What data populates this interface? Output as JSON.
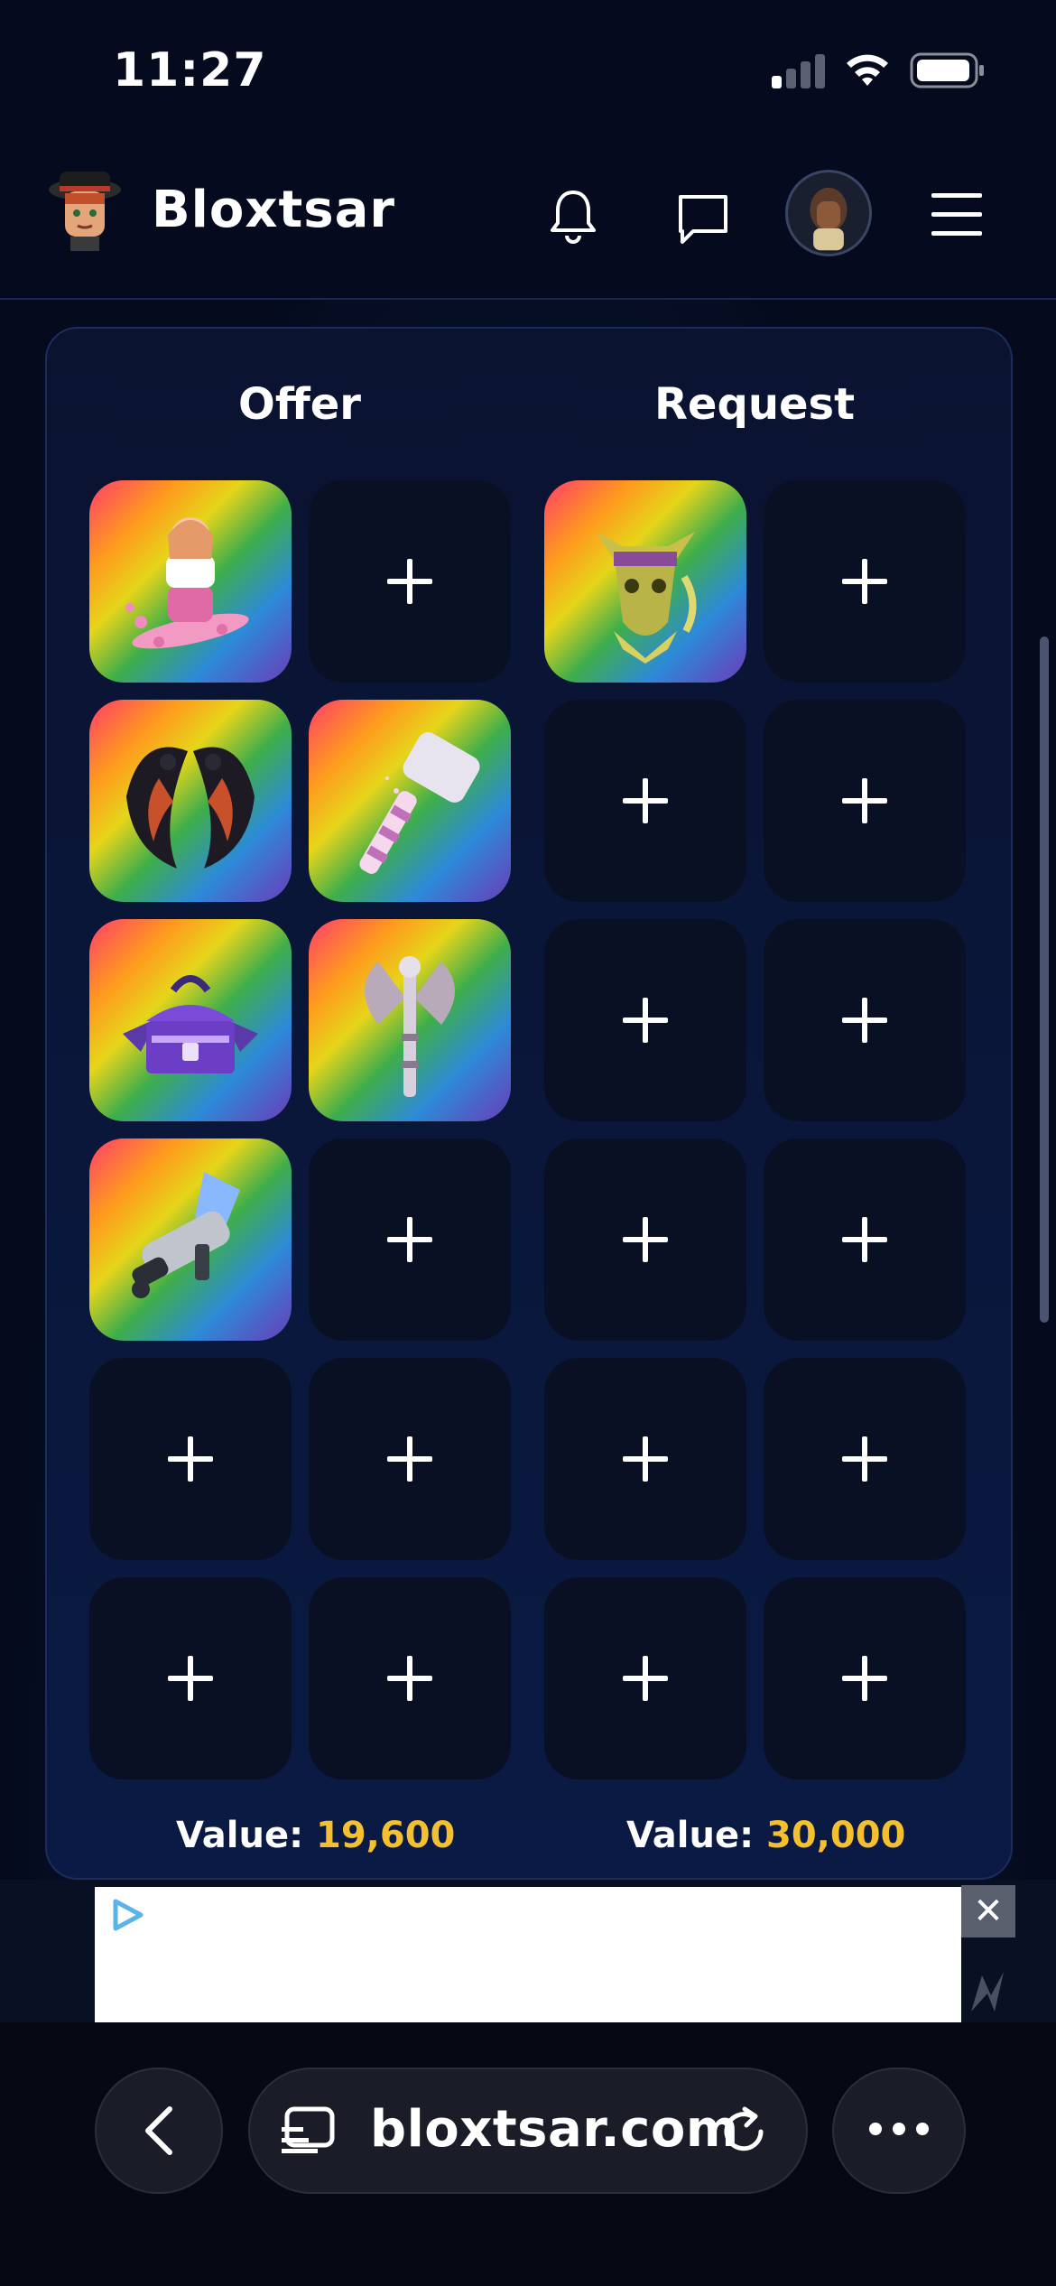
{
  "status_bar": {
    "time": "11:27"
  },
  "header": {
    "brand": "Bloxtsar"
  },
  "trade": {
    "offer_title": "Offer",
    "request_title": "Request",
    "offer_value_label": "Value:",
    "offer_value": "19,600",
    "request_value_label": "Value:",
    "request_value": "30,000",
    "offer_items": [
      "skater-girl-pet",
      "add-slot",
      "dragon-wings",
      "candy-hammer",
      "purple-treasure-chest",
      "silver-battle-axe",
      "ice-blaster-gun",
      "add-slot",
      "add-slot",
      "add-slot",
      "add-slot",
      "add-slot"
    ],
    "request_items": [
      "golden-pharaoh-mask",
      "add-slot",
      "add-slot",
      "add-slot",
      "add-slot",
      "add-slot",
      "add-slot",
      "add-slot",
      "add-slot",
      "add-slot",
      "add-slot",
      "add-slot"
    ]
  },
  "ad": {
    "close_label": "✕"
  },
  "browser": {
    "url": "bloxtsar.com"
  },
  "colors": {
    "accent_value": "#f5c030",
    "panel_border": "#1c2d5c"
  }
}
